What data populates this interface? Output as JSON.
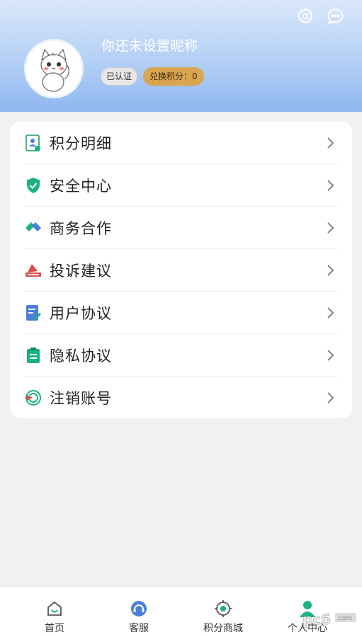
{
  "header": {
    "nickname": "你还未设置昵称",
    "verified_badge": "已认证",
    "points_badge": "兑换积分：0",
    "settings_icon": "gear-icon",
    "message_icon": "chat-bubble-icon"
  },
  "menu": {
    "items": [
      {
        "label": "积分明细",
        "icon": "points-detail-icon"
      },
      {
        "label": "安全中心",
        "icon": "shield-icon"
      },
      {
        "label": "商务合作",
        "icon": "handshake-icon"
      },
      {
        "label": "投诉建议",
        "icon": "complaint-icon"
      },
      {
        "label": "用户协议",
        "icon": "user-agreement-icon"
      },
      {
        "label": "隐私协议",
        "icon": "privacy-icon"
      },
      {
        "label": "注销账号",
        "icon": "logout-icon"
      }
    ]
  },
  "tabbar": {
    "tabs": [
      {
        "label": "首页",
        "icon": "home-icon"
      },
      {
        "label": "客服",
        "icon": "headset-icon"
      },
      {
        "label": "积分商城",
        "icon": "target-icon"
      },
      {
        "label": "个人中心",
        "icon": "person-icon"
      }
    ]
  },
  "watermark": {
    "text": "pc6",
    "suffix": ".com"
  },
  "colors": {
    "header_top": "#dbe8fb",
    "header_bottom": "#8fb7f0",
    "points_badge": "#d9a54e",
    "accent_green": "#1ab37d"
  }
}
